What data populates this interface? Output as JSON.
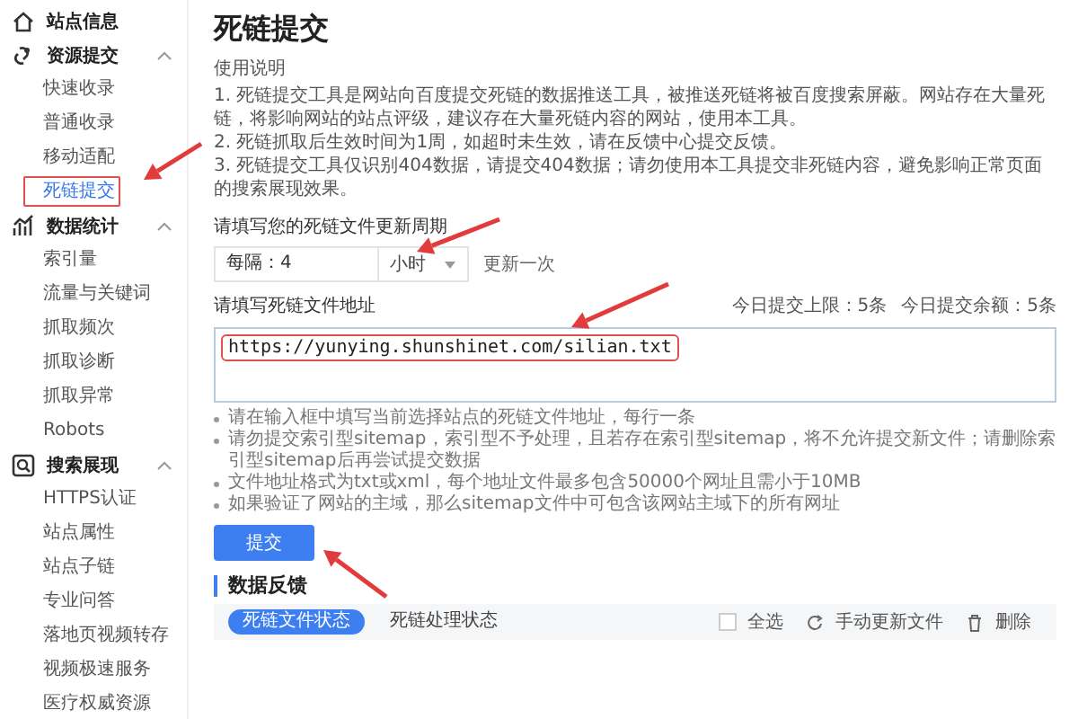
{
  "sidebar": [
    {
      "label": "站点信息"
    },
    {
      "label": "资源提交",
      "expanded": true,
      "children": [
        {
          "label": "快速收录",
          "selected": false,
          "annotated": false
        },
        {
          "label": "普通收录",
          "selected": false,
          "annotated": false
        },
        {
          "label": "移动适配",
          "selected": false,
          "annotated": false
        },
        {
          "label": "死链提交",
          "selected": true,
          "annotated": true
        }
      ]
    },
    {
      "label": "数据统计",
      "expanded": true,
      "children": [
        {
          "label": "索引量",
          "selected": false,
          "annotated": false
        },
        {
          "label": "流量与关键词",
          "selected": false,
          "annotated": false
        },
        {
          "label": "抓取频次",
          "selected": false,
          "annotated": false
        },
        {
          "label": "抓取诊断",
          "selected": false,
          "annotated": false
        },
        {
          "label": "抓取异常",
          "selected": false,
          "annotated": false
        },
        {
          "label": "Robots",
          "selected": false,
          "annotated": false
        }
      ]
    },
    {
      "label": "搜索展现",
      "expanded": true,
      "children": [
        {
          "label": "HTTPS认证",
          "selected": false,
          "annotated": false
        },
        {
          "label": "站点属性",
          "selected": false,
          "annotated": false
        },
        {
          "label": "站点子链",
          "selected": false,
          "annotated": false
        },
        {
          "label": "专业问答",
          "selected": false,
          "annotated": false
        },
        {
          "label": "落地页视频转存",
          "selected": false,
          "annotated": false
        },
        {
          "label": "视频极速服务",
          "selected": false,
          "annotated": false
        },
        {
          "label": "医疗权威资源",
          "selected": false,
          "annotated": false
        }
      ]
    }
  ],
  "page": {
    "title": "死链提交",
    "usage_heading": "使用说明",
    "instructions": [
      "1. 死链提交工具是网站向百度提交死链的数据推送工具，被推送死链将被百度搜索屏蔽。网站存在大量死链，将影响网站的站点评级，建议存在大量死链内容的网站，使用本工具。",
      "2. 死链抓取后生效时间为1周，如超时未生效，请在反馈中心提交反馈。",
      "3. 死链提交工具仅识别404数据，请提交404数据；请勿使用本工具提交非死链内容，避免影响正常页面的搜索展现效果。"
    ],
    "frequency": {
      "label": "请填写您的死链文件更新周期",
      "value": "每隔：4",
      "unit": "小时",
      "suffix": "更新一次"
    },
    "address": {
      "label": "请填写死链文件地址",
      "quota": [
        "今日提交上限：5条",
        "今日提交余额：5条"
      ],
      "value": "https://yunying.shunshinet.com/silian.txt",
      "annotated": true
    },
    "notes": [
      "请在输入框中填写当前选择站点的死链文件地址，每行一条",
      "请勿提交索引型sitemap，索引型不予处理，且若存在索引型sitemap，将不允许提交新文件；请删除索引型sitemap后再尝试提交数据",
      "文件地址格式为txt或xml，每个地址文件最多包含50000个网址且需小于10MB",
      "如果验证了网站的主域，那么sitemap文件中可包含该网站主域下的所有网址"
    ],
    "submit": "提交",
    "feedback": {
      "heading": "数据反馈",
      "tabs": [
        {
          "label": "死链文件状态",
          "selected": true
        },
        {
          "label": "死链处理状态",
          "selected": false
        }
      ],
      "select_all": {
        "label": "全选",
        "checked": false
      },
      "actions": [
        "手动更新文件",
        "删除"
      ]
    }
  }
}
